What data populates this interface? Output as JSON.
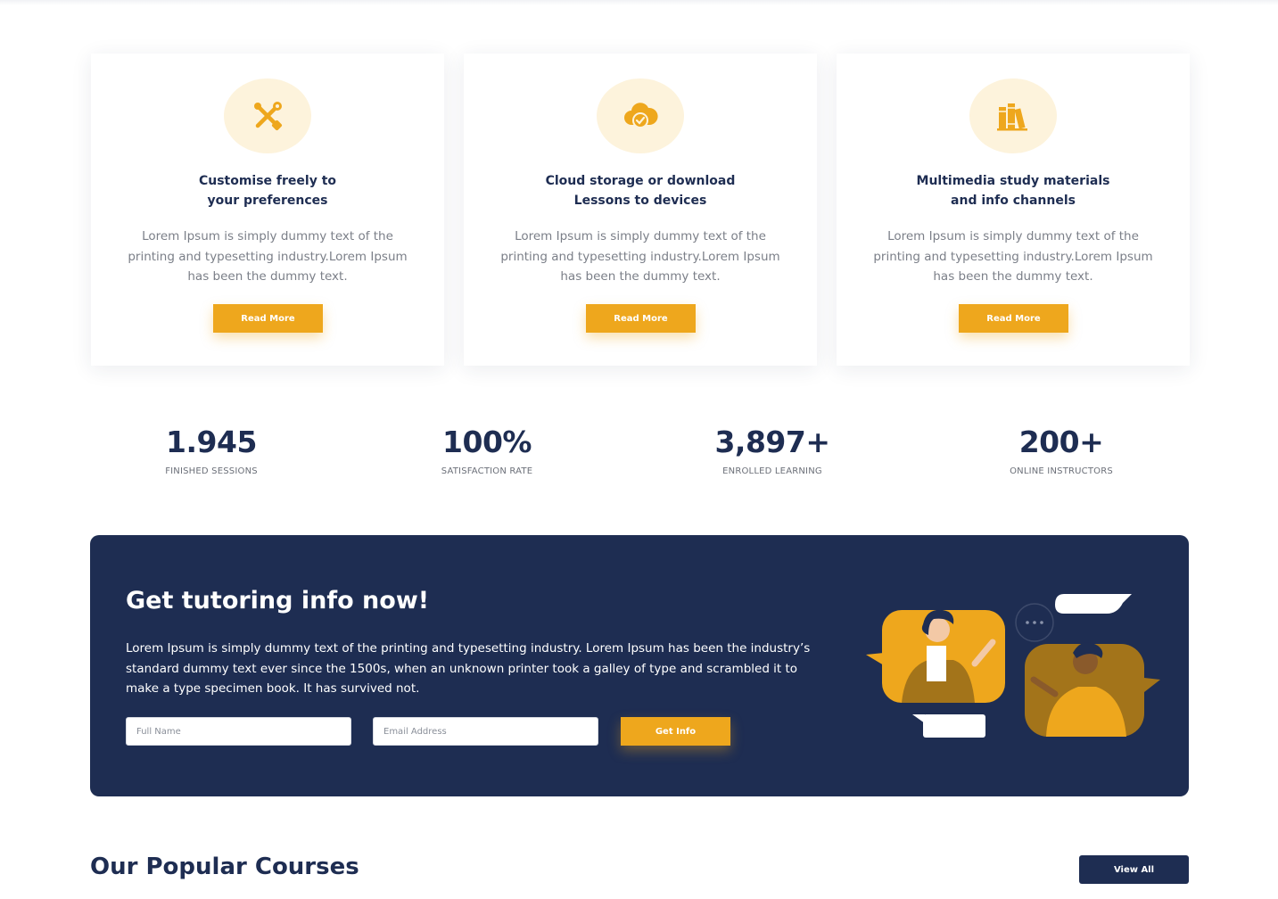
{
  "features": [
    {
      "icon": "tools-icon",
      "title": "Customise freely to\nyour preferences",
      "text": "Lorem Ipsum is simply dummy text of the printing and typesetting industry.Lorem Ipsum has been the dummy text.",
      "button": "Read More"
    },
    {
      "icon": "cloud-check-icon",
      "title": "Cloud storage or download\nLessons to devices",
      "text": "Lorem Ipsum is simply dummy text of the printing and typesetting industry.Lorem Ipsum has been the dummy text.",
      "button": "Read More"
    },
    {
      "icon": "books-icon",
      "title": "Multimedia study materials\nand info channels",
      "text": "Lorem Ipsum is simply dummy text of the printing and typesetting industry.Lorem Ipsum has been the dummy text.",
      "button": "Read More"
    }
  ],
  "stats": [
    {
      "value": "1.945",
      "label": "FINISHED SESSIONS"
    },
    {
      "value": "100%",
      "label": "SATISFACTION RATE"
    },
    {
      "value": "3,897+",
      "label": "ENROLLED LEARNING"
    },
    {
      "value": "200+",
      "label": "ONLINE INSTRUCTORS"
    }
  ],
  "banner": {
    "title": "Get tutoring info now!",
    "text": "Lorem Ipsum is simply dummy text of the printing and typesetting industry. Lorem Ipsum has been the industry’s standard dummy text ever since the 1500s, when an unknown printer took a galley of type and scrambled it to make a type specimen book. It has survived not.",
    "name_placeholder": "Full Name",
    "email_placeholder": "Email Address",
    "button": "Get Info"
  },
  "courses": {
    "title": "Our Popular Courses",
    "button": "View All"
  },
  "colors": {
    "accent": "#eea71d",
    "navy": "#1e2d52",
    "icon_bg": "#fdf3dc"
  }
}
